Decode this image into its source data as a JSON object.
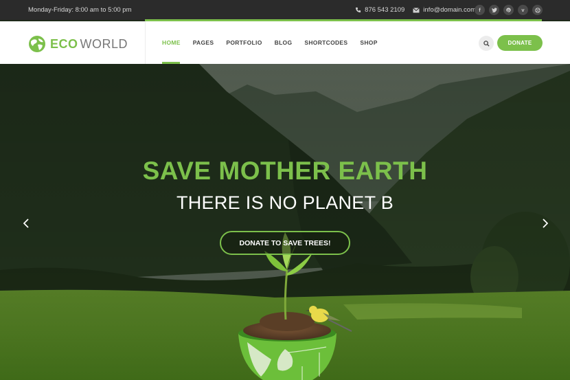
{
  "topbar": {
    "hours": "Monday-Friday: 8:00 am to 5:00 pm",
    "phone": "876 543 2109",
    "email": "info@domain.com",
    "socials": [
      "facebook-icon",
      "twitter-icon",
      "pinterest-icon",
      "vimeo-icon",
      "dribbble-icon"
    ]
  },
  "header": {
    "logo_eco": "ECO",
    "logo_world": "WORLD",
    "nav": [
      "HOME",
      "PAGES",
      "PORTFOLIO",
      "BLOG",
      "SHORTCODES",
      "SHOP"
    ],
    "active_nav": "HOME",
    "donate_label": "DONATE"
  },
  "hero": {
    "headline": "SAVE MOTHER EARTH",
    "subline": "THERE IS NO PLANET B",
    "cta_label": "DONATE TO SAVE TREES!"
  },
  "colors": {
    "accent": "#7cc04b",
    "topbar_bg": "#2b2b2b"
  }
}
